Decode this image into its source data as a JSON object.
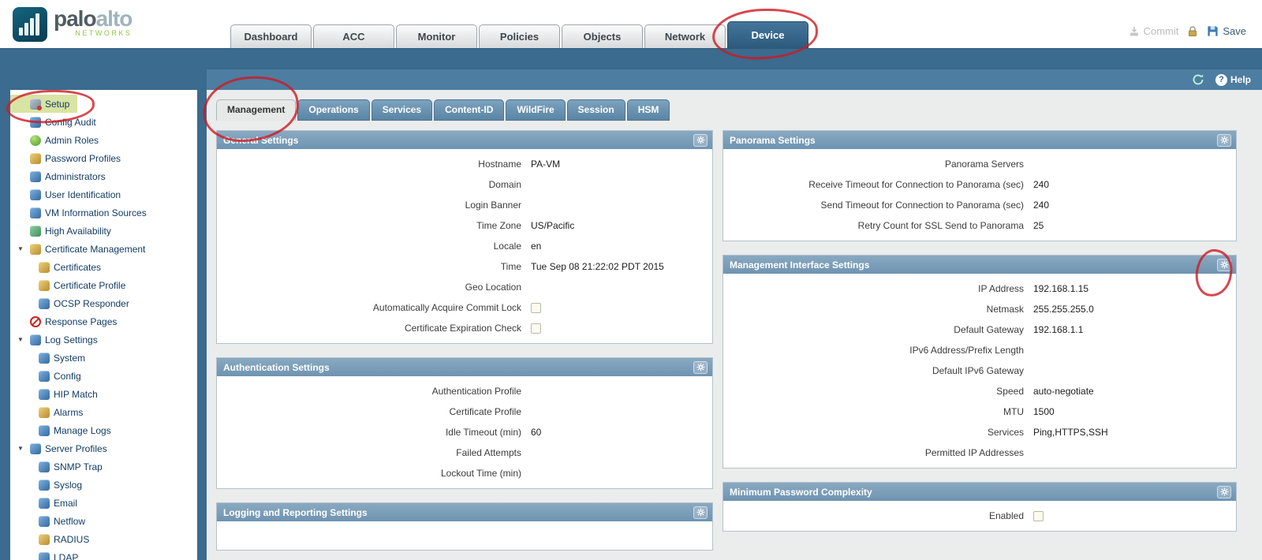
{
  "colors": {
    "header_band": "#3b6b8e",
    "active_tab": "#2d5f80",
    "panel_header": "#7ba0bd",
    "selected_item_bg": "#d9e3a3",
    "annotation_red": "#cd1923",
    "brand_green": "#8dc63f"
  },
  "brand": {
    "wordmark_dark": "palo",
    "wordmark_light": "alto",
    "subtext": "NETWORKS"
  },
  "header": {
    "active_tab": "Device",
    "nav_tabs": [
      {
        "label": "Dashboard"
      },
      {
        "label": "ACC"
      },
      {
        "label": "Monitor"
      },
      {
        "label": "Policies"
      },
      {
        "label": "Objects"
      },
      {
        "label": "Network"
      },
      {
        "label": "Device",
        "active": true
      }
    ],
    "actions": {
      "commit": "Commit",
      "save": "Save"
    }
  },
  "toolbar": {
    "help": "Help"
  },
  "sidebar": {
    "items": [
      {
        "label": "Setup",
        "icon": "setup-icon",
        "depth": 0,
        "selected": true
      },
      {
        "label": "Config Audit",
        "icon": "config-audit-icon",
        "depth": 0
      },
      {
        "label": "Admin Roles",
        "icon": "admin-roles-icon",
        "depth": 0
      },
      {
        "label": "Password Profiles",
        "icon": "password-profiles-icon",
        "depth": 0
      },
      {
        "label": "Administrators",
        "icon": "administrators-icon",
        "depth": 0
      },
      {
        "label": "User Identification",
        "icon": "user-identification-icon",
        "depth": 0
      },
      {
        "label": "VM Information Sources",
        "icon": "vm-information-sources-icon",
        "depth": 0
      },
      {
        "label": "High Availability",
        "icon": "high-availability-icon",
        "depth": 0
      },
      {
        "label": "Certificate Management",
        "icon": "certificate-management-icon",
        "depth": 0,
        "expandable": true
      },
      {
        "label": "Certificates",
        "icon": "certificates-icon",
        "depth": 1
      },
      {
        "label": "Certificate Profile",
        "icon": "certificate-profile-icon",
        "depth": 1
      },
      {
        "label": "OCSP Responder",
        "icon": "ocsp-responder-icon",
        "depth": 1
      },
      {
        "label": "Response Pages",
        "icon": "response-pages-icon",
        "depth": 0
      },
      {
        "label": "Log Settings",
        "icon": "log-settings-icon",
        "depth": 0,
        "expandable": true
      },
      {
        "label": "System",
        "icon": "system-log-icon",
        "depth": 1
      },
      {
        "label": "Config",
        "icon": "config-log-icon",
        "depth": 1
      },
      {
        "label": "HIP Match",
        "icon": "hip-match-icon",
        "depth": 1
      },
      {
        "label": "Alarms",
        "icon": "alarms-icon",
        "depth": 1
      },
      {
        "label": "Manage Logs",
        "icon": "manage-logs-icon",
        "depth": 1
      },
      {
        "label": "Server Profiles",
        "icon": "server-profiles-icon",
        "depth": 0,
        "expandable": true
      },
      {
        "label": "SNMP Trap",
        "icon": "snmp-trap-icon",
        "depth": 1
      },
      {
        "label": "Syslog",
        "icon": "syslog-icon",
        "depth": 1
      },
      {
        "label": "Email",
        "icon": "email-icon",
        "depth": 1
      },
      {
        "label": "Netflow",
        "icon": "netflow-icon",
        "depth": 1
      },
      {
        "label": "RADIUS",
        "icon": "radius-icon",
        "depth": 1
      },
      {
        "label": "LDAP",
        "icon": "ldap-icon",
        "depth": 1
      }
    ]
  },
  "subtabs": {
    "active": "Management",
    "tabs": [
      "Management",
      "Operations",
      "Services",
      "Content-ID",
      "WildFire",
      "Session",
      "HSM"
    ]
  },
  "panels": {
    "left": [
      {
        "id": "general-settings",
        "title": "General Settings",
        "rows": [
          {
            "label": "Hostname",
            "value": "PA-VM"
          },
          {
            "label": "Domain",
            "value": ""
          },
          {
            "label": "Login Banner",
            "value": ""
          },
          {
            "label": "Time Zone",
            "value": "US/Pacific"
          },
          {
            "label": "Locale",
            "value": "en"
          },
          {
            "label": "Time",
            "value": "Tue Sep 08 21:22:02 PDT 2015"
          },
          {
            "label": "Geo Location",
            "value": ""
          },
          {
            "label": "Automatically Acquire Commit Lock",
            "type": "checkbox",
            "checked": false
          },
          {
            "label": "Certificate Expiration Check",
            "type": "checkbox",
            "checked": false
          }
        ]
      },
      {
        "id": "authentication-settings",
        "title": "Authentication Settings",
        "rows": [
          {
            "label": "Authentication Profile",
            "value": ""
          },
          {
            "label": "Certificate Profile",
            "value": ""
          },
          {
            "label": "Idle Timeout (min)",
            "value": "60"
          },
          {
            "label": "Failed Attempts",
            "value": ""
          },
          {
            "label": "Lockout Time (min)",
            "value": ""
          }
        ]
      },
      {
        "id": "logging-and-reporting-settings",
        "title": "Logging and Reporting Settings",
        "rows": []
      }
    ],
    "right": [
      {
        "id": "panorama-settings",
        "title": "Panorama Settings",
        "rows": [
          {
            "label": "Panorama Servers",
            "value": ""
          },
          {
            "label": "Receive Timeout for Connection to Panorama (sec)",
            "value": "240"
          },
          {
            "label": "Send Timeout for Connection to Panorama (sec)",
            "value": "240"
          },
          {
            "label": "Retry Count for SSL Send to Panorama",
            "value": "25"
          }
        ]
      },
      {
        "id": "management-interface-settings",
        "title": "Management Interface Settings",
        "rows": [
          {
            "label": "IP Address",
            "value": "192.168.1.15"
          },
          {
            "label": "Netmask",
            "value": "255.255.255.0"
          },
          {
            "label": "Default Gateway",
            "value": "192.168.1.1"
          },
          {
            "label": "IPv6 Address/Prefix Length",
            "value": ""
          },
          {
            "label": "Default IPv6 Gateway",
            "value": ""
          },
          {
            "label": "Speed",
            "value": "auto-negotiate"
          },
          {
            "label": "MTU",
            "value": "1500"
          },
          {
            "label": "Services",
            "value": "Ping,HTTPS,SSH"
          },
          {
            "label": "Permitted IP Addresses",
            "value": ""
          }
        ]
      },
      {
        "id": "minimum-password-complexity",
        "title": "Minimum Password Complexity",
        "rows": [
          {
            "label": "Enabled",
            "type": "checkbox",
            "checked": false
          }
        ]
      }
    ]
  },
  "annotations": [
    {
      "target": "device-tab",
      "note": "red circle around Device tab"
    },
    {
      "target": "setup-item",
      "note": "red circle around Setup sidebar item"
    },
    {
      "target": "management-tab",
      "note": "red circle around Management subtab"
    },
    {
      "target": "management-interface-gear",
      "note": "red circle around Management Interface Settings gear"
    }
  ]
}
